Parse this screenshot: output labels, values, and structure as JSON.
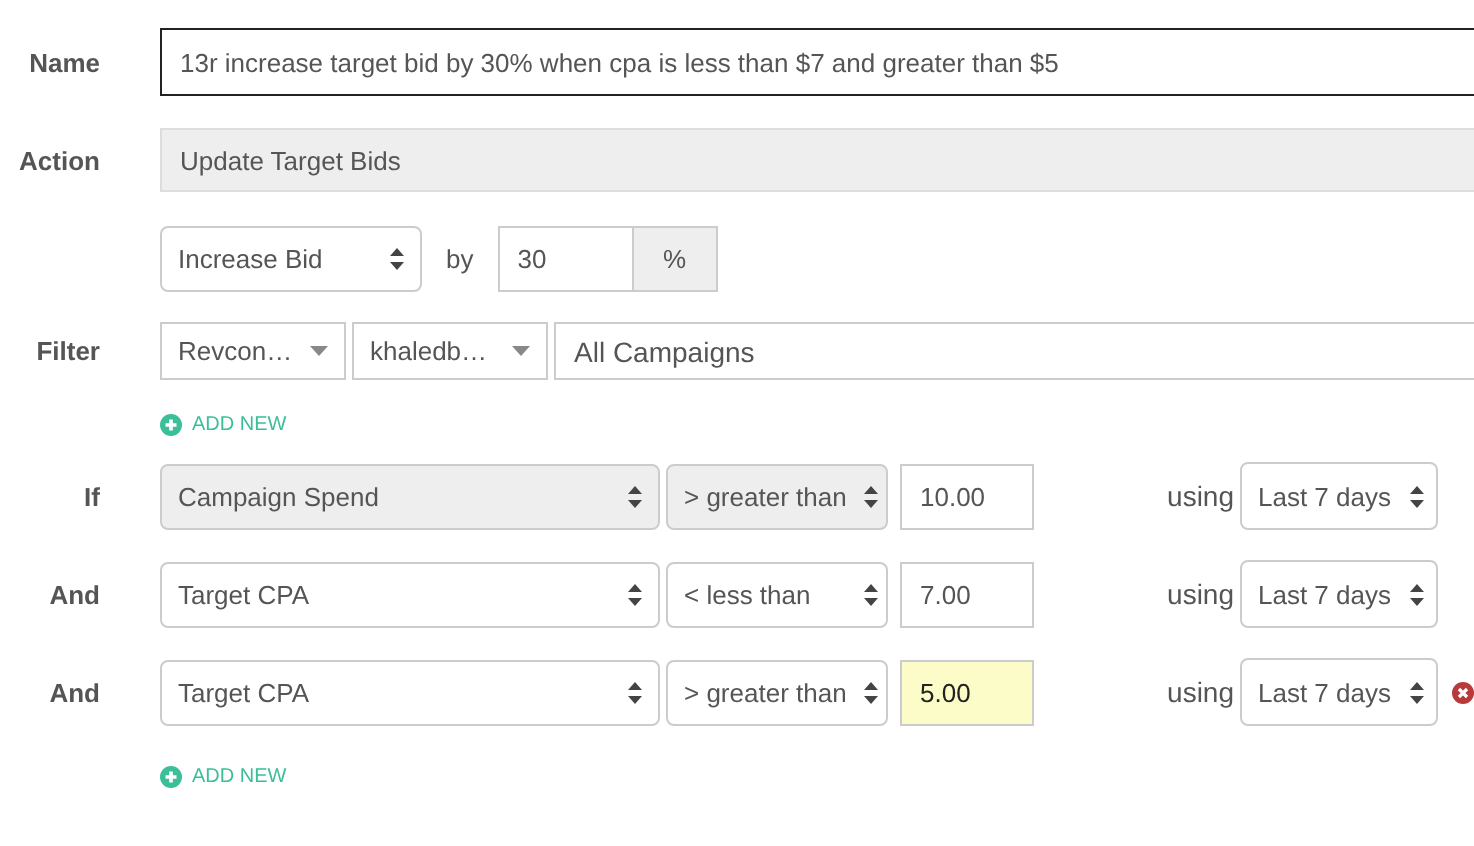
{
  "name": {
    "label": "Name",
    "value": "13r increase target bid by 30% when cpa is less than $7 and greater than $5"
  },
  "action": {
    "label": "Action",
    "value": "Update Target Bids",
    "disabled": true
  },
  "adjust": {
    "mode": "Increase Bid",
    "by_label": "by",
    "amount": "30",
    "unit": "%"
  },
  "filter": {
    "label": "Filter",
    "selects": [
      "Revcon…",
      "khaledb…"
    ],
    "campaigns": "All Campaigns",
    "add_new": "ADD NEW"
  },
  "conditions": [
    {
      "label": "If",
      "metric": "Campaign Spend",
      "operator": "> greater than",
      "value": "10.00",
      "disabled": true,
      "focused": false,
      "using_label": "using",
      "timeframe": "Last 7 days",
      "removable": false
    },
    {
      "label": "And",
      "metric": "Target CPA",
      "operator": "< less than",
      "value": "7.00",
      "disabled": false,
      "focused": false,
      "using_label": "using",
      "timeframe": "Last 7 days",
      "removable": false
    },
    {
      "label": "And",
      "metric": "Target CPA",
      "operator": "> greater than",
      "value": "5.00",
      "disabled": false,
      "focused": true,
      "using_label": "using",
      "timeframe": "Last 7 days",
      "removable": true
    }
  ],
  "conditions_add_new": "ADD NEW"
}
